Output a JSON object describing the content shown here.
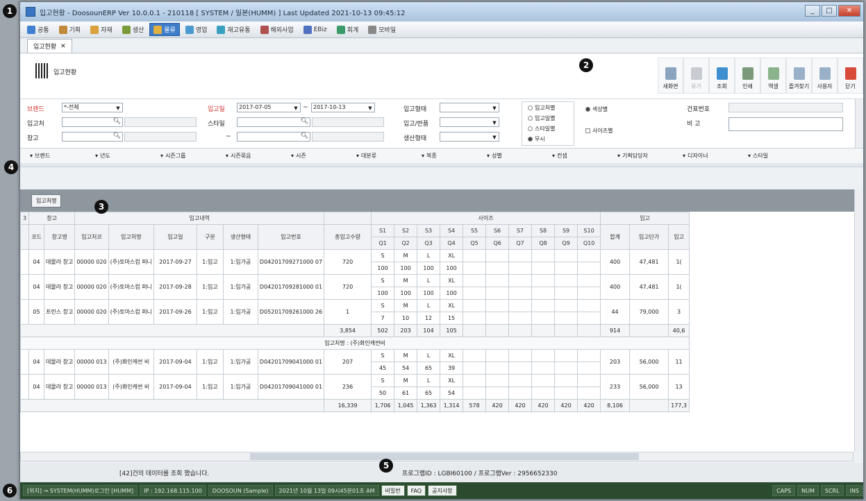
{
  "window": {
    "title": "입고현황 - DoosounERP Ver 10.0.0.1 - 210118 [ SYSTEM / 일본(HUMM) ]    Last Updated 2021-10-13 09:45:12",
    "btn_min": "_",
    "btn_max": "□",
    "btn_close": "✕"
  },
  "menu": [
    {
      "label": "공통",
      "color": "#3f7fd0"
    },
    {
      "label": "기획",
      "color": "#c08a3a"
    },
    {
      "label": "자재",
      "color": "#d9a03b"
    },
    {
      "label": "생산",
      "color": "#7a9a3a"
    },
    {
      "label": "물류",
      "color": "#e0b040"
    },
    {
      "label": "영업",
      "color": "#4a9ad0"
    },
    {
      "label": "재고유통",
      "color": "#3aa0c0"
    },
    {
      "label": "해외사업",
      "color": "#b05050"
    },
    {
      "label": "EBiz",
      "color": "#5070c0"
    },
    {
      "label": "회계",
      "color": "#3a9a6a"
    },
    {
      "label": "모바일",
      "color": "#888888"
    }
  ],
  "doctab": {
    "label": "입고현황",
    "close": "✕"
  },
  "page_title": "입고현황",
  "toolbar": [
    "새화면",
    "유가",
    "조회",
    "인쇄",
    "엑셀",
    "즐겨찾기",
    "사용자",
    "닫기"
  ],
  "filters": {
    "brand_label": "브랜드",
    "brand_value": "*-전체",
    "vendor_label": "입고처",
    "warehouse_label": "창고",
    "date_label": "입고일",
    "date_from": "2017-07-05",
    "date_sep": "~",
    "date_to": "2017-10-13",
    "style_label": "스타일",
    "tilde": "~",
    "intype_label": "입고형태",
    "inout_label": "입고/반품",
    "prodtype_label": "생산형태",
    "radio_group": [
      "입고처별",
      "입고일별",
      "스타일별",
      "무시"
    ],
    "color_radio": "색상별",
    "size_check": "사이즈별",
    "deliv_label": "건표번호",
    "remark_label": "비   고"
  },
  "column_filters": [
    "브랜드",
    "년도",
    "시즌그룹",
    "시즌묶음",
    "시즌",
    "대분류",
    "복종",
    "성별",
    "컨셉",
    "기획담당자",
    "디자이너",
    "스타일"
  ],
  "group_chip": "입고처명",
  "grid": {
    "hdr_top": {
      "c0": "3",
      "wh": "창고",
      "inlist": "입고내역",
      "size": "사이즈",
      "ins": "입고"
    },
    "cols": [
      "코드",
      "창고명",
      "입고처코",
      "입고처명",
      "입고일",
      "구분",
      "생산형태",
      "입고번호",
      "총입고수량"
    ],
    "sizes_top": [
      "S1",
      "S2",
      "S3",
      "S4",
      "S5",
      "S6",
      "S7",
      "S8",
      "S9",
      "S10"
    ],
    "sizes_bot": [
      "Q1",
      "Q2",
      "Q3",
      "Q4",
      "Q5",
      "Q6",
      "Q7",
      "Q8",
      "Q9",
      "Q10"
    ],
    "tail": [
      "합계",
      "입고단가",
      "입고"
    ],
    "rows1": [
      {
        "code": "04",
        "wh": "데몰라 창고",
        "vc": "00000 020",
        "vn": "(주)토마스컴 퍼니",
        "date": "2017-09-27",
        "gb": "1:입고",
        "pt": "1:임가공",
        "no": "D04201709271000 07",
        "qty": "720",
        "sz": [
          "S",
          "M",
          "L",
          "XL"
        ],
        "q": [
          "100",
          "100",
          "100",
          "100"
        ],
        "sum": "400",
        "price": "47,481",
        "amt": "1("
      },
      {
        "code": "04",
        "wh": "데몰라 창고",
        "vc": "00000 020",
        "vn": "(주)토마스컴 퍼니",
        "date": "2017-09-28",
        "gb": "1:입고",
        "pt": "1:임가공",
        "no": "D04201709281000 01",
        "qty": "720",
        "sz": [
          "S",
          "M",
          "L",
          "XL"
        ],
        "q": [
          "100",
          "100",
          "100",
          "100"
        ],
        "sum": "400",
        "price": "47,481",
        "amt": "1("
      },
      {
        "code": "05",
        "wh": "프린스 창고",
        "vc": "00000 020",
        "vn": "(주)토마스컴 퍼니",
        "date": "2017-09-26",
        "gb": "1:입고",
        "pt": "1:임가공",
        "no": "D05201709261000 26",
        "qty": "1",
        "sz": [
          "S",
          "M",
          "L",
          "XL"
        ],
        "q": [
          "7",
          "10",
          "12",
          "15"
        ],
        "sum": "44",
        "price": "79,000",
        "amt": "3"
      }
    ],
    "sum1": {
      "qty": "3,854",
      "sizes": [
        "502",
        "203",
        "104",
        "105"
      ],
      "total": "914",
      "amt": "40,6"
    },
    "group2": "입고처명 : (주)화인캐썬비",
    "rows2": [
      {
        "code": "04",
        "wh": "데몰라 창고",
        "vc": "00000 013",
        "vn": "(주)화인캐썬 비",
        "date": "2017-09-04",
        "gb": "1:입고",
        "pt": "1:임가공",
        "no": "D04201709041000 01",
        "qty": "207",
        "sz": [
          "S",
          "M",
          "L",
          "XL"
        ],
        "q": [
          "45",
          "54",
          "65",
          "39"
        ],
        "sum": "203",
        "price": "56,000",
        "amt": "11"
      },
      {
        "code": "04",
        "wh": "데몰라 창고",
        "vc": "00000 013",
        "vn": "(주)화인캐썬 비",
        "date": "2017-09-04",
        "gb": "1:입고",
        "pt": "1:임가공",
        "no": "D04201709041000 01",
        "qty": "236",
        "sz": [
          "S",
          "M",
          "L",
          "XL"
        ],
        "q": [
          "50",
          "61",
          "65",
          "54"
        ],
        "sum": "233",
        "price": "56,000",
        "amt": "13"
      }
    ],
    "sum2": {
      "qty": "16,339",
      "sizes": [
        "1,706",
        "1,045",
        "1,363",
        "1,314",
        "578",
        "420",
        "420",
        "420",
        "420",
        "420"
      ],
      "total": "8,106",
      "amt": "177,3"
    }
  },
  "message": "[42]건의 데이터를 조회 했습니다.",
  "program": "프로그램ID : LGBI60100 / 프로그램Ver : 2956652330",
  "status": [
    "[위치] → SYSTEM(HUMM)로그인 [HUMM]",
    "IP : 192.168.115.100",
    "DOOSOUN (Sample)",
    "2021년 10월 13일 09시45분01초 AM",
    "비밀번",
    "FAQ",
    "공지사항",
    "CAPS",
    "NUM",
    "SCRL",
    "INS"
  ],
  "callouts": [
    "1",
    "2",
    "3",
    "4",
    "5",
    "6"
  ]
}
